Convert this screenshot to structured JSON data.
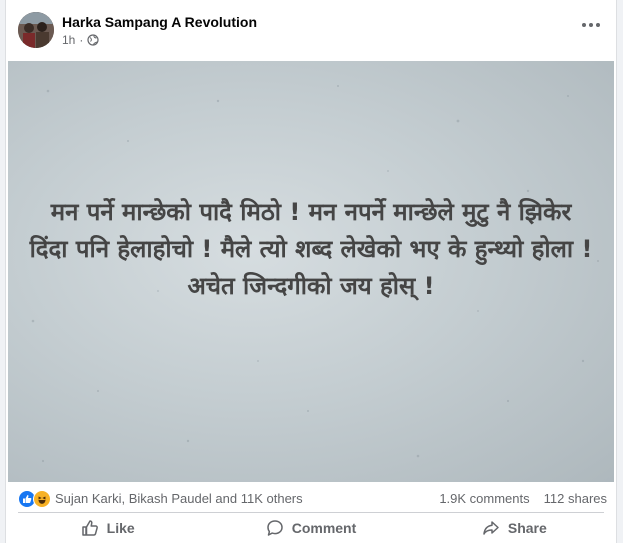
{
  "post": {
    "author": "Harka Sampang A Revolution",
    "time": "1h",
    "audience_icon": "globe-icon",
    "more_icon": "more-horizontal-icon",
    "text": "मन पर्ने मान्छेको पादै मिठो ! मन नपर्ने मान्छेले मुटु नै झिकेर दिंदा पनि हेलाहोचो ! मैले त्यो शब्द लेखेको भए के हुन्थ्यो होला ! अचेत जिन्दगीको जय होस् !"
  },
  "reactions": {
    "icons": [
      "like-icon",
      "haha-icon"
    ],
    "names": "Sujan Karki, Bikash Paudel and 11K others",
    "comments": "1.9K comments",
    "shares": "112 shares"
  },
  "actions": {
    "like": "Like",
    "comment": "Comment",
    "share": "Share"
  },
  "colors": {
    "accent": "#1877f2",
    "haha": "#f7b125",
    "secondary_text": "#65676b"
  }
}
